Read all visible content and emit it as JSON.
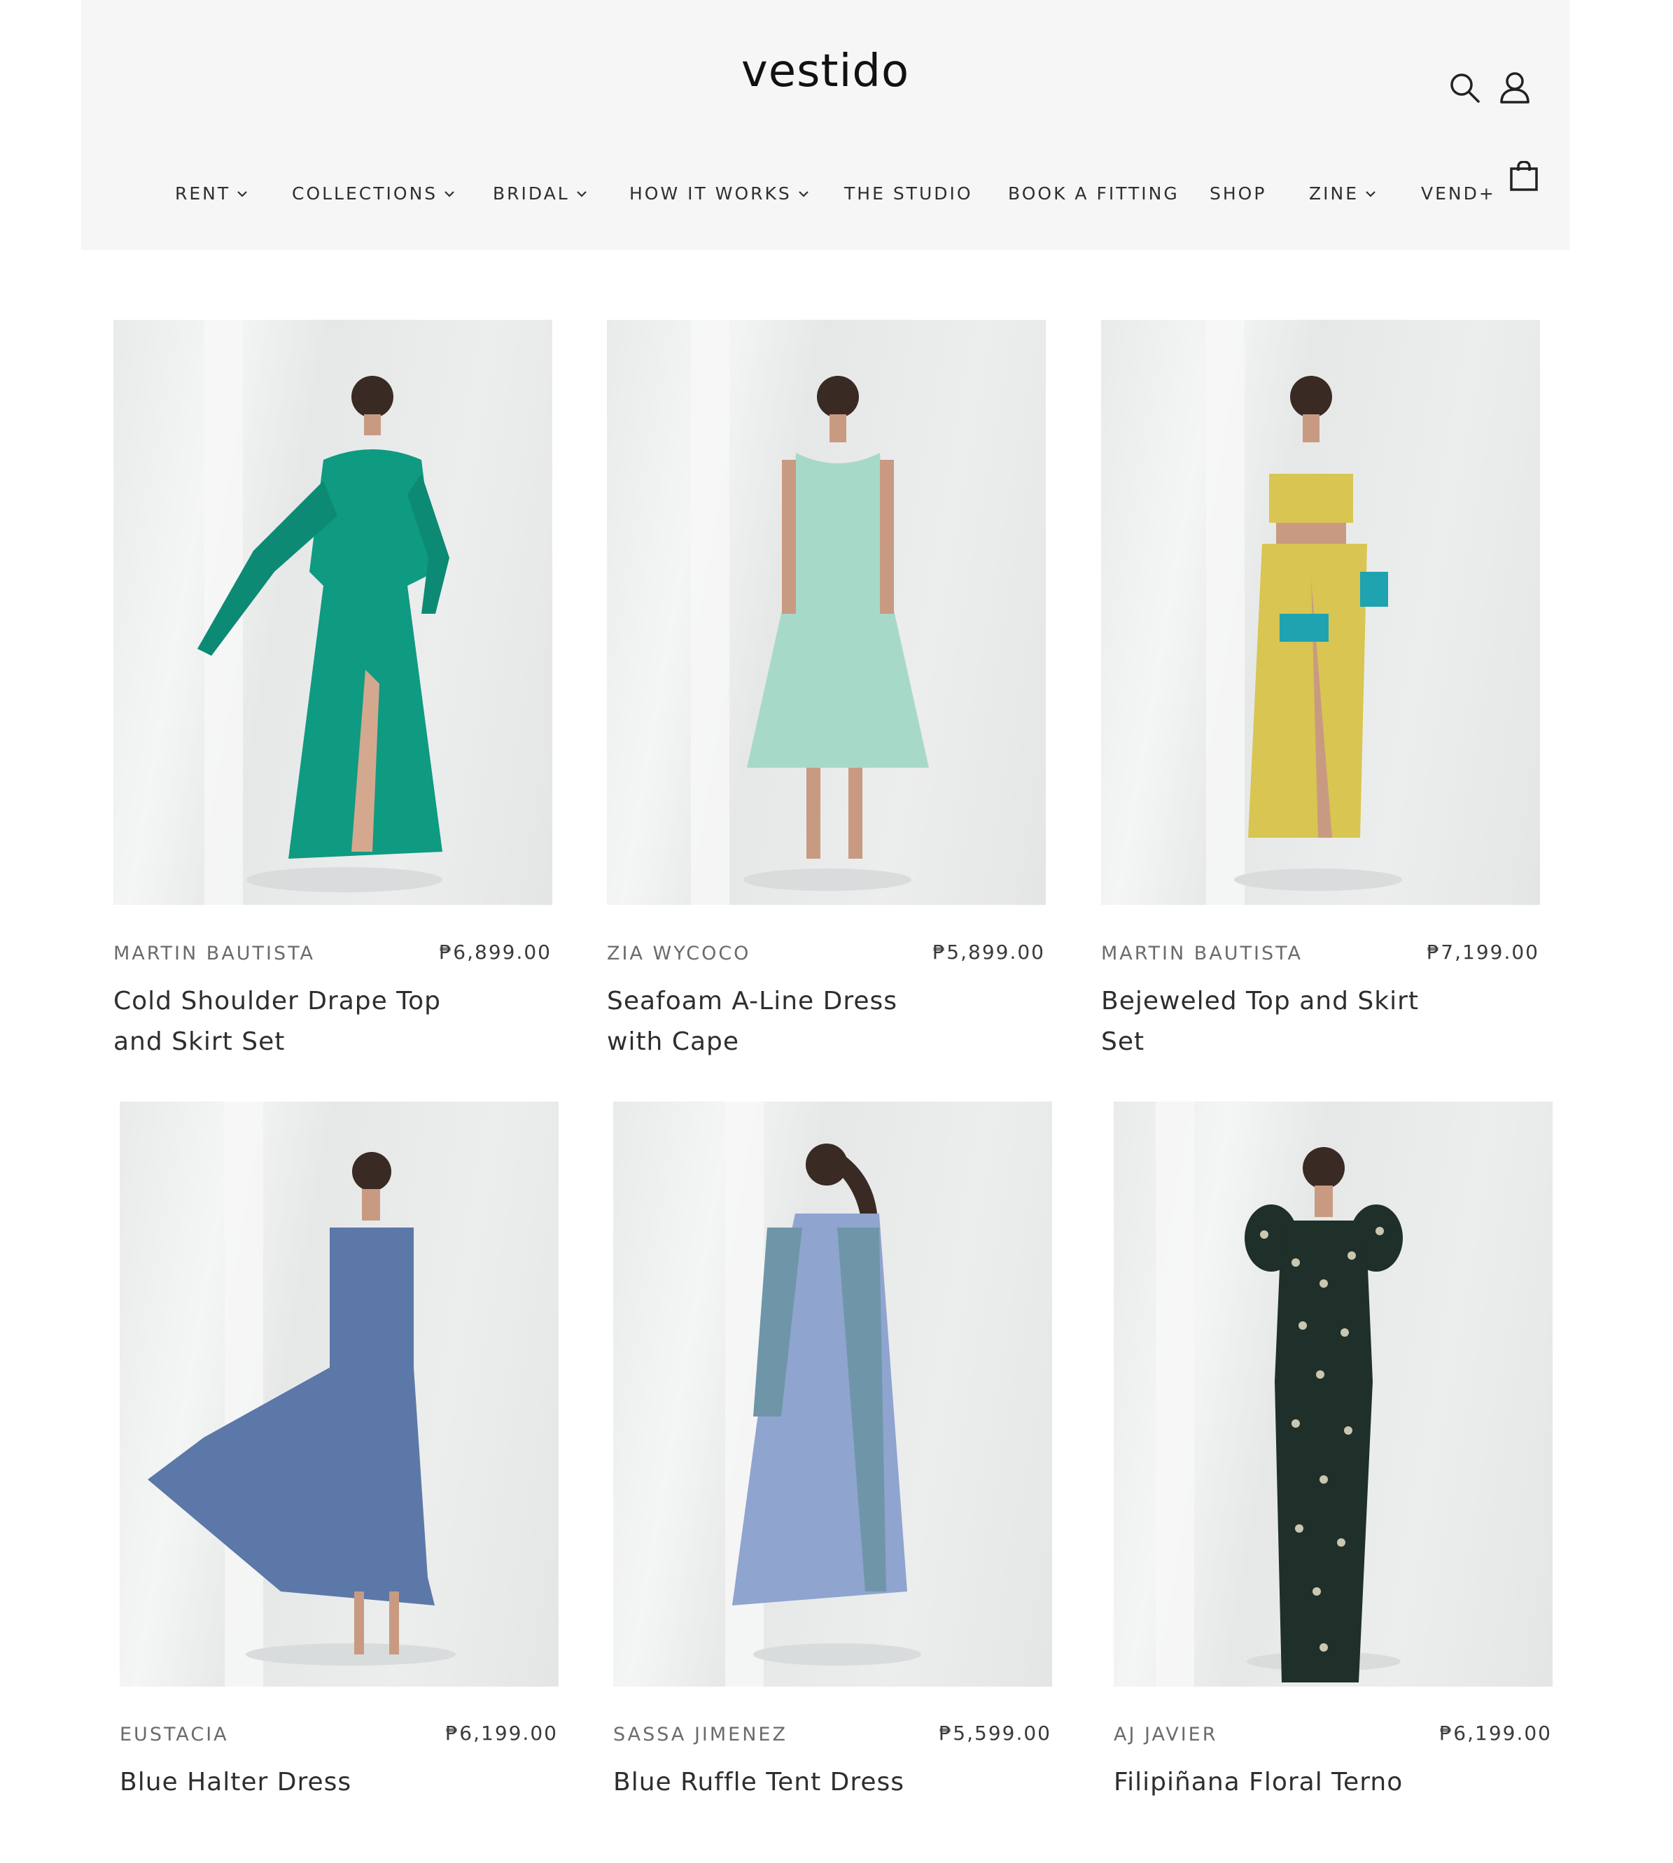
{
  "brand": {
    "logo_text": "vestido"
  },
  "header": {
    "icons": [
      "search-icon",
      "account-icon",
      "cart-icon"
    ],
    "nav": [
      {
        "label": "RENT",
        "dropdown": true
      },
      {
        "label": "COLLECTIONS",
        "dropdown": true
      },
      {
        "label": "BRIDAL",
        "dropdown": true
      },
      {
        "label": "HOW IT WORKS",
        "dropdown": true
      },
      {
        "label": "THE STUDIO",
        "dropdown": false
      },
      {
        "label": "BOOK A FITTING",
        "dropdown": false
      },
      {
        "label": "SHOP",
        "dropdown": false
      },
      {
        "label": "ZINE",
        "dropdown": true
      },
      {
        "label": "VEND+",
        "dropdown": false
      }
    ]
  },
  "products": [
    {
      "vendor": "MARTIN BAUTISTA",
      "price": "₱6,899.00",
      "title": "Cold Shoulder Drape Top and Skirt Set",
      "color": "#0f9a82"
    },
    {
      "vendor": "ZIA WYCOCO",
      "price": "₱5,899.00",
      "title": "Seafoam A-Line Dress with Cape",
      "color": "#a7d9c9"
    },
    {
      "vendor": "MARTIN BAUTISTA",
      "price": "₱7,199.00",
      "title": "Bejeweled Top and Skirt Set",
      "color": "#d8c552"
    },
    {
      "vendor": "EUSTACIA",
      "price": "₱6,199.00",
      "title": "Blue Halter Dress",
      "color": "#5b78a8"
    },
    {
      "vendor": "SASSA JIMENEZ",
      "price": "₱5,599.00",
      "title": "Blue Ruffle Tent Dress",
      "color": "#8fa4cf"
    },
    {
      "vendor": "AJ JAVIER",
      "price": "₱6,199.00",
      "title": "Filipiñana Floral Terno",
      "color": "#1f2f2a"
    }
  ]
}
